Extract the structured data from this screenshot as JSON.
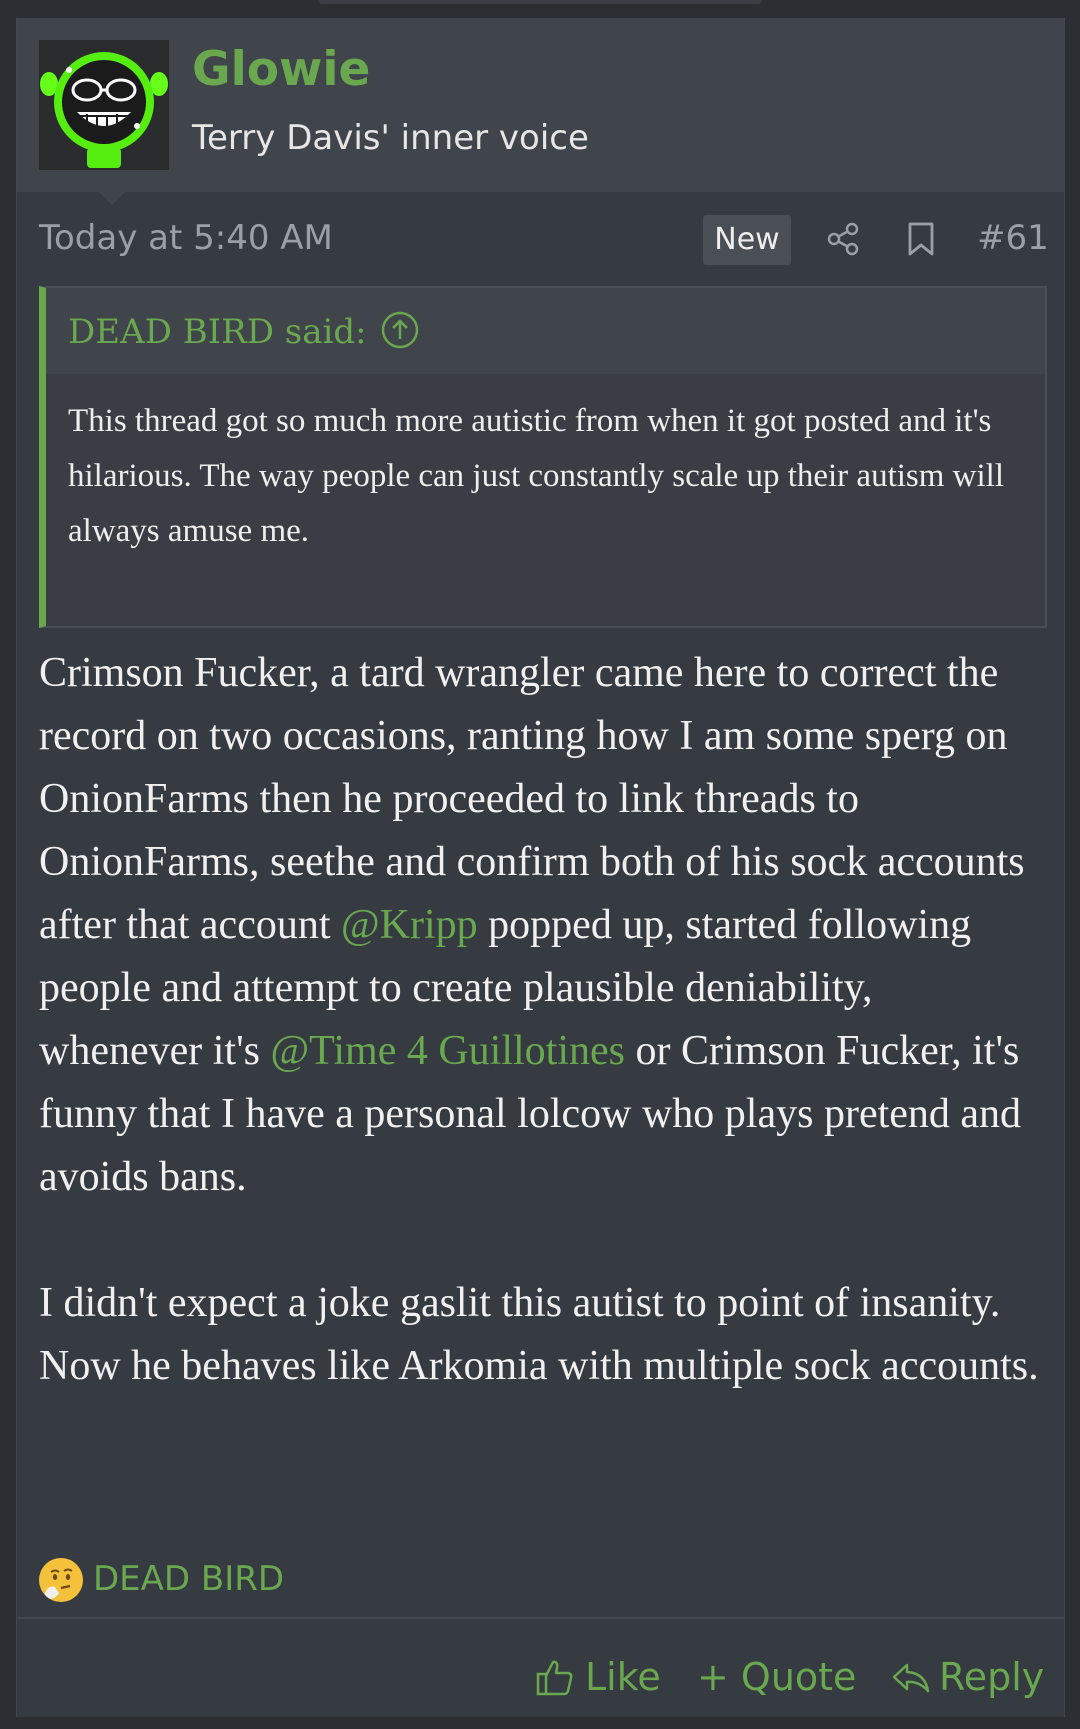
{
  "user": {
    "name": "Glowie",
    "title": "Terry Davis' inner voice"
  },
  "post": {
    "date": "Today at 5:40 AM",
    "badge": "New",
    "number": "#61"
  },
  "quote": {
    "attribution": "DEAD BIRD said:",
    "text": "This thread got so much more autistic from when it got posted and it's hilarious. The way people can just constantly scale up their autism will always amuse me."
  },
  "message": {
    "p1_a": "Crimson Fucker, a tard wrangler came here to correct the record on two occasions, ranting how I am some sperg on OnionFarms then he proceeded to link threads to OnionFarms, seethe and confirm both of his sock accounts after that account ",
    "mention1": "@Kripp",
    "p1_b": " popped up, started following people and attempt to create plausible deniability, whenever it's ",
    "mention2": "@Time 4 Guillotines",
    "p1_c": " or Crimson Fucker, it's funny that I have a personal lolcow who plays pretend and avoids bans.",
    "p2": "I didn't expect a joke gaslit this autist to point of insanity. Now he behaves like Arkomia with multiple sock accounts."
  },
  "reactions": {
    "emoji": "thinking-face-icon",
    "by": "DEAD BIRD"
  },
  "actions": {
    "like": "Like",
    "quote": "+ Quote",
    "reply": "Reply"
  },
  "colors": {
    "accent": "#6aa84f",
    "background": "#363a41",
    "header": "#40444b"
  }
}
